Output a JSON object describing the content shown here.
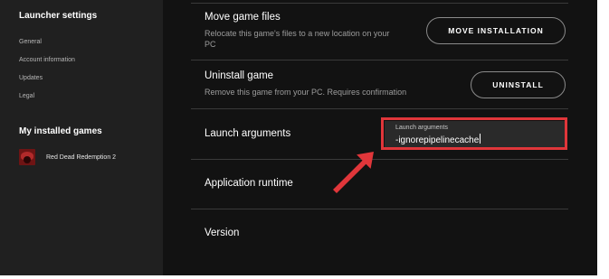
{
  "sidebar": {
    "title": "Launcher settings",
    "links": [
      "General",
      "Account information",
      "Updates",
      "Legal"
    ],
    "games_heading": "My installed games",
    "game": {
      "name": "Red Dead Redemption 2",
      "icon": "rdr2-game-icon"
    }
  },
  "rows": {
    "move": {
      "title": "Move game files",
      "desc_line1": "Relocate this game's files to a new location on your",
      "desc_line2": "PC",
      "button": "MOVE INSTALLATION"
    },
    "uninstall": {
      "title": "Uninstall game",
      "desc": "Remove this game from your PC. Requires confirmation",
      "button": "UNINSTALL"
    },
    "launch": {
      "title": "Launch arguments",
      "field_label": "Launch arguments",
      "field_value": "-ignorepipelinecache"
    },
    "runtime": {
      "title": "Application runtime"
    },
    "version": {
      "title": "Version"
    }
  },
  "colors": {
    "background": "#121212",
    "sidebar": "#202020",
    "highlight": "#e0363a"
  },
  "annotation": {
    "icon": "red-arrow-icon"
  }
}
